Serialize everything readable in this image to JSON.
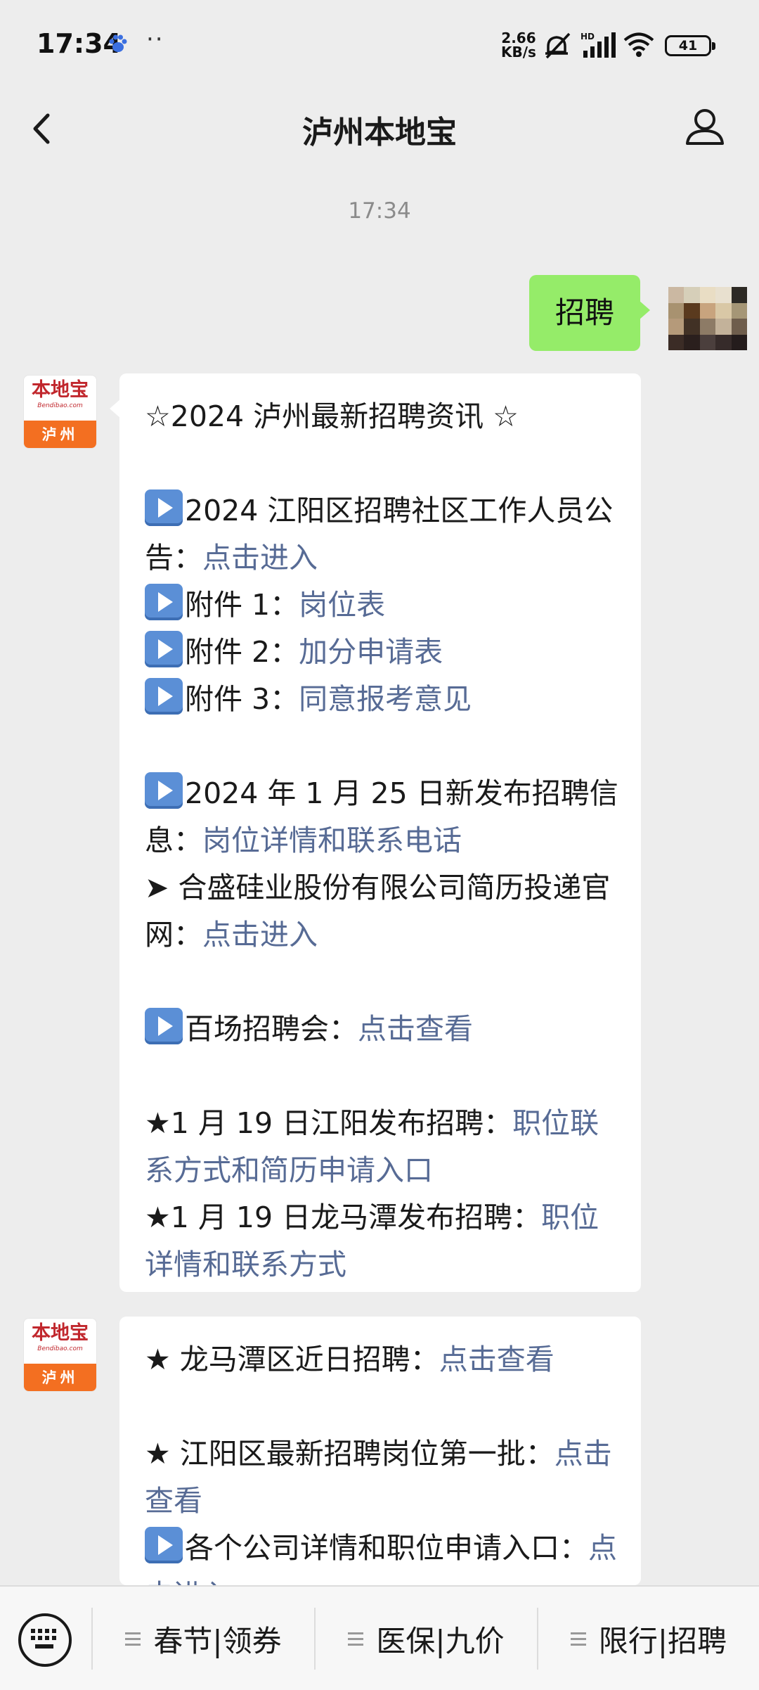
{
  "status_bar": {
    "time": "17:34",
    "dots": "··",
    "speed_value": "2.66",
    "speed_unit": "KB/s",
    "signal_label": "HD",
    "battery": "41"
  },
  "nav": {
    "title": "泸州本地宝"
  },
  "chat": {
    "timestamp": "17:34",
    "sent_message": "招聘",
    "bot_avatar_cn": "本地宝",
    "bot_avatar_en": "Bendibao.com",
    "bot_avatar_city": "泸州",
    "message1": {
      "title": "☆2024 泸州最新招聘资讯 ☆",
      "item1_text": "2024 江阳区招聘社区工作人员公告：",
      "item1_link": "点击进入",
      "attach1_text": "附件 1：",
      "attach1_link": "岗位表",
      "attach2_text": "附件 2：",
      "attach2_link": "加分申请表",
      "attach3_text": "附件 3：",
      "attach3_link": "同意报考意见",
      "item2_text": "2024 年 1 月 25 日新发布招聘信息：",
      "item2_link": "岗位详情和联系电话",
      "item3_text": "➤ 合盛硅业股份有限公司简历投递官网：",
      "item3_link": "点击进入",
      "item4_text": "百场招聘会：",
      "item4_link": "点击查看",
      "item5_text": "★1 月 19 日江阳发布招聘：",
      "item5_link": "职位联系方式和简历申请入口",
      "item6_text": "★1 月 19 日龙马潭发布招聘：",
      "item6_link": "职位详情和联系方式"
    },
    "message2": {
      "item1_text": "★ 龙马潭区近日招聘：",
      "item1_link": "点击查看",
      "item2_text": "★ 江阳区最新招聘岗位第一批：",
      "item2_link": "点击查看",
      "item3_text": "各个公司详情和职位申请入口：",
      "item3_link": "点击进入"
    }
  },
  "bottom_menu": {
    "items": [
      "春节|领券",
      "医保|九价",
      "限行|招聘"
    ]
  },
  "colors": {
    "sent_bubble": "#95ec69",
    "link": "#576b95",
    "background": "#ededed",
    "brand_orange": "#f36f21"
  }
}
